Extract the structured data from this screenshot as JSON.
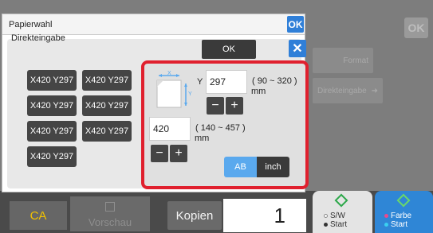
{
  "background": {
    "ok_label": "OK",
    "field1_text": "Format",
    "field2_text": "Direkteingabe"
  },
  "dialog": {
    "title": "Papierwahl",
    "ok_label": "OK",
    "inner_title": "Direkteingabe",
    "inner_ok_label": "OK",
    "close_icon": "close-icon",
    "sizes": [
      "X420 Y297",
      "X420 Y297",
      "X420 Y297",
      "X420 Y297",
      "X420 Y297",
      "X420 Y297",
      "X420 Y297"
    ],
    "direct_entry": {
      "y_label": "Y",
      "y_value": "297",
      "y_range": "( 90 ~ 320 )",
      "y_unit": "mm",
      "x_value": "420",
      "x_range": "( 140 ~ 457 )",
      "x_unit": "mm",
      "minus": "−",
      "plus": "+",
      "unit_ab": "AB",
      "unit_inch": "inch",
      "accent_color": "#e0202e"
    }
  },
  "bottom": {
    "ca_label": "CA",
    "preview_label": "Vorschau",
    "copies_label": "Kopien",
    "copies_value": "1",
    "start_bw_line1": "S/W",
    "start_bw_line2": "Start",
    "start_color_line1": "Farbe",
    "start_color_line2": "Start"
  }
}
